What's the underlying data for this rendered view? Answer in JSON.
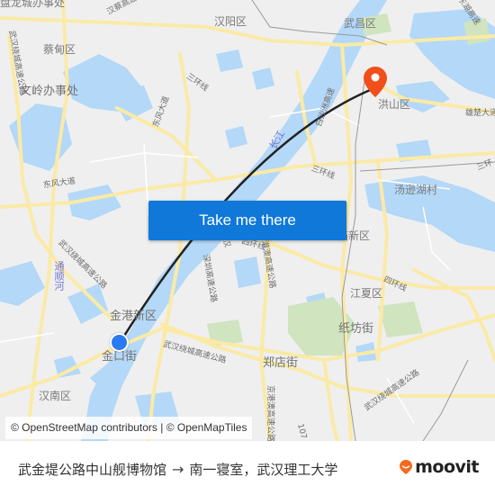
{
  "map": {
    "labels": {
      "top_left_district": "盘龙城办事处",
      "caidian": "蔡甸区",
      "wenling": "文岭办事处",
      "hanyang": "汉阳区",
      "wuchang": "武昌区",
      "hongshan": "洪山区",
      "jingang": "金港新区",
      "jinkou": "金口街",
      "hannan": "汉南区",
      "zhengdian": "郑店街",
      "jiangxia": "江夏区",
      "zhifang": "纸坊街",
      "tangxun": "汤逊湖村",
      "nanhu": "庙新区"
    },
    "roads": {
      "hancai_expressway": "汉蔡高速",
      "ring_expressway_left": "武汉绕城高速公路",
      "ring_expressway_mid": "武汉绕城高速公路",
      "ring_expressway_right": "武汉绕城高速公路",
      "third_ring_nw": "三环线",
      "third_ring_e": "三环线",
      "third_ring_far_e": "三环",
      "dongfeng_ave": "东风大道",
      "dongfeng_ave2": "东风大道",
      "fourth_ring_w": "四环线",
      "fourth_ring_e": "四环线",
      "shenzhen_expressway": "深圳高速公路",
      "wuhan_short": "武汉",
      "jinggang_expressway": "京港澳高速公路",
      "jingzheng_expressway": "京港澳高速公路",
      "route_107": "107",
      "baishazhou": "白沙洲高速",
      "xiongchu": "雄楚大道",
      "east_lake": "东湖高速",
      "second_ring": "高速"
    },
    "water": {
      "yangtze": "长江",
      "tongshun": "通顺河"
    },
    "attribution": "© OpenStreetMap contributors | © OpenMapTiles",
    "cta_label": "Take me there",
    "colors": {
      "land": "#efefef",
      "water": "#b4d8f7",
      "road": "#fbeaa6",
      "park": "#cfe4bf",
      "route_line": "#222222",
      "origin": "#2b7bf0",
      "destination": "#f04e1a",
      "cta": "#0f78d9"
    }
  },
  "footer": {
    "origin": "武金堤公路中山舰博物馆",
    "arrow": "→",
    "destination": "南一寝室，武汉理工大学",
    "brand": "moovit",
    "brand_color": "#f26a1b"
  }
}
